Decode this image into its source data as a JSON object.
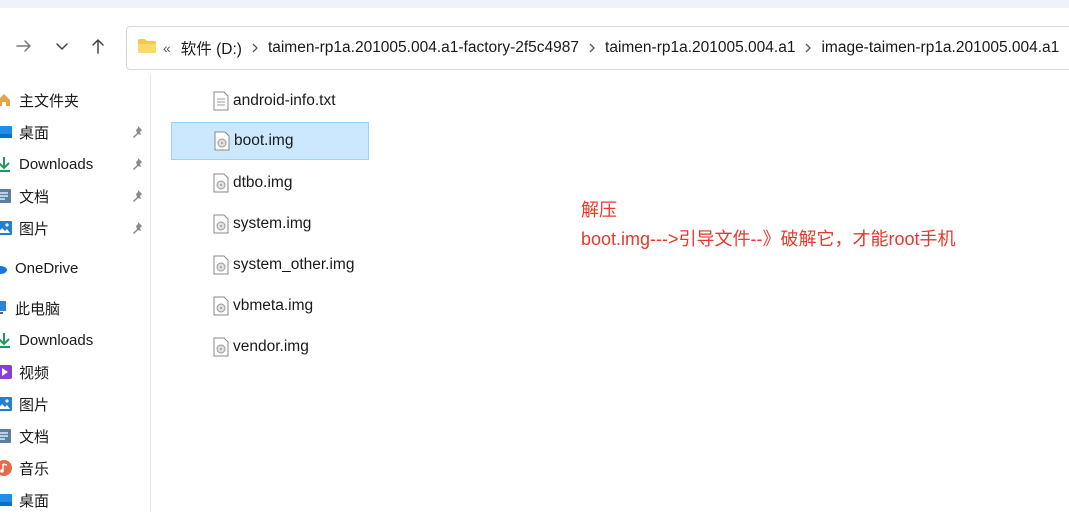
{
  "nav": {
    "forward_label": "→",
    "dropdown_label": "⌄",
    "up_label": "↑"
  },
  "address": {
    "overflow": "«",
    "segments": [
      "软件 (D:)",
      "taimen-rp1a.201005.004.a1-factory-2f5c4987",
      "taimen-rp1a.201005.004.a1",
      "image-taimen-rp1a.201005.004.a1"
    ]
  },
  "sidebar": {
    "items": [
      {
        "label": "主文件夹",
        "icon": "home-icon",
        "pinned": false
      },
      {
        "label": "桌面",
        "icon": "desktop-icon",
        "pinned": true
      },
      {
        "label": "Downloads",
        "icon": "download-icon",
        "pinned": true
      },
      {
        "label": "文档",
        "icon": "document-icon",
        "pinned": true
      },
      {
        "label": "图片",
        "icon": "picture-icon",
        "pinned": true
      },
      {
        "label": "OneDrive",
        "icon": "cloud-icon",
        "pinned": false
      },
      {
        "label": "此电脑",
        "icon": "computer-icon",
        "pinned": false
      },
      {
        "label": "Downloads",
        "icon": "download-icon",
        "pinned": false
      },
      {
        "label": "视频",
        "icon": "video-icon",
        "pinned": false
      },
      {
        "label": "图片",
        "icon": "picture-icon",
        "pinned": false
      },
      {
        "label": "文档",
        "icon": "document-icon",
        "pinned": false
      },
      {
        "label": "音乐",
        "icon": "music-icon",
        "pinned": false
      },
      {
        "label": "桌面",
        "icon": "desktop-icon",
        "pinned": false
      }
    ]
  },
  "files": [
    {
      "name": "android-info.txt",
      "icon": "text-file-icon",
      "selected": false
    },
    {
      "name": "boot.img",
      "icon": "disk-image-icon",
      "selected": true
    },
    {
      "name": "dtbo.img",
      "icon": "disk-image-icon",
      "selected": false
    },
    {
      "name": "system.img",
      "icon": "disk-image-icon",
      "selected": false
    },
    {
      "name": "system_other.img",
      "icon": "disk-image-icon",
      "selected": false
    },
    {
      "name": "vbmeta.img",
      "icon": "disk-image-icon",
      "selected": false
    },
    {
      "name": "vendor.img",
      "icon": "disk-image-icon",
      "selected": false
    }
  ],
  "annotation": {
    "line1": "解压",
    "line2": "boot.img--->引导文件--》破解它，才能root手机",
    "color": "#e8382a"
  },
  "colors": {
    "selection_bg": "#cce8ff",
    "selection_border": "#99d1ff",
    "accent": "#0078d4"
  }
}
